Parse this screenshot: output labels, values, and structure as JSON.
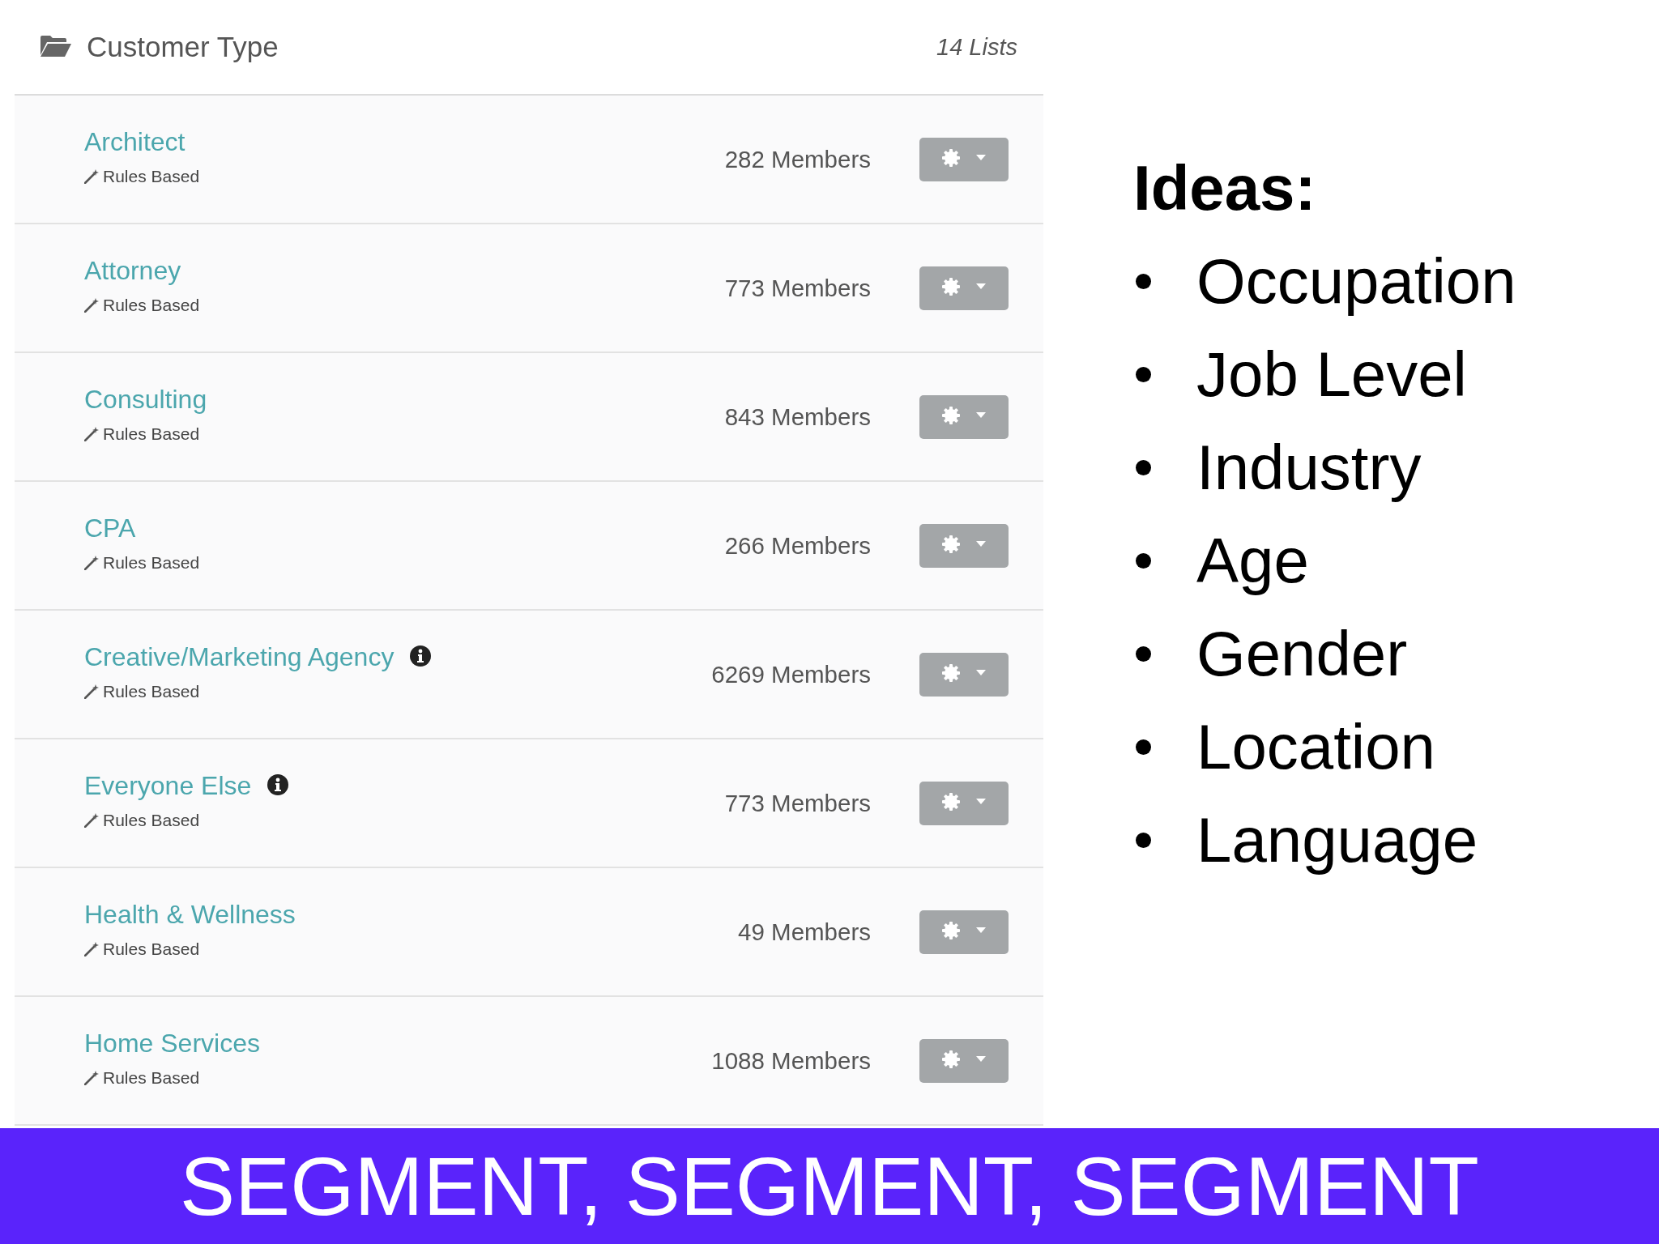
{
  "list_header": {
    "title": "Customer Type",
    "count": "14 Lists"
  },
  "lists": [
    {
      "name": "Architect",
      "info": false,
      "type": "Rules Based",
      "members": "282 Members"
    },
    {
      "name": "Attorney",
      "info": false,
      "type": "Rules Based",
      "members": "773 Members"
    },
    {
      "name": "Consulting",
      "info": false,
      "type": "Rules Based",
      "members": "843 Members"
    },
    {
      "name": "CPA",
      "info": false,
      "type": "Rules Based",
      "members": "266 Members"
    },
    {
      "name": "Creative/Marketing Agency",
      "info": true,
      "type": "Rules Based",
      "members": "6269 Members"
    },
    {
      "name": "Everyone Else",
      "info": true,
      "type": "Rules Based",
      "members": "773 Members"
    },
    {
      "name": "Health & Wellness",
      "info": false,
      "type": "Rules Based",
      "members": "49 Members"
    },
    {
      "name": "Home Services",
      "info": false,
      "type": "Rules Based",
      "members": "1088 Members"
    }
  ],
  "ideas": {
    "title": "Ideas:",
    "items": [
      "Occupation",
      "Job Level",
      "Industry",
      "Age",
      "Gender",
      "Location",
      "Language"
    ]
  },
  "banner": "SEGMENT, SEGMENT, SEGMENT"
}
